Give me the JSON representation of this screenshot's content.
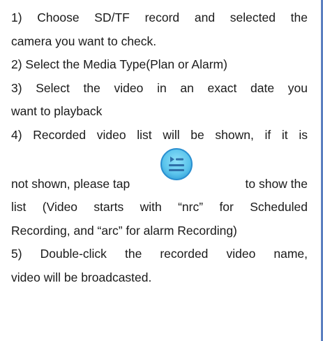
{
  "instructions": {
    "step1_line1": [
      "1)",
      "Choose",
      "SD/TF",
      "record",
      "and",
      "selected",
      "the"
    ],
    "step1_line2": "camera you want to check.",
    "step2": "2) Select the Media Type(Plan or Alarm)",
    "step3_line1": [
      "3)",
      "Select",
      "the",
      "video",
      "in",
      "an",
      "exact",
      "date",
      "you"
    ],
    "step3_line2": "want to playback",
    "step4_line1": [
      "4)",
      "Recorded",
      "video",
      "list",
      "will",
      "be",
      "shown,",
      "if",
      "it",
      "is"
    ],
    "step4_line2_left": "not shown, please tap",
    "step4_line2_right": "to show the",
    "step4_line3": [
      "list",
      "(Video",
      "starts",
      "with",
      "“nrc”",
      "for",
      "Scheduled"
    ],
    "step4_line4": "Recording, and “arc” for alarm Recording)",
    "step5_line1": [
      "5)",
      "Double-click",
      "the",
      "recorded",
      "video",
      "name,"
    ],
    "step5_line2": "video will be broadcasted."
  },
  "icons": {
    "list_button": "playlist-icon"
  },
  "colors": {
    "text": "#1a1a1a",
    "border": "#5b7fc0",
    "icon_fill": "#5bc4ec",
    "icon_ring": "#2a8fd0",
    "icon_glyph": "#2e6fa8"
  }
}
